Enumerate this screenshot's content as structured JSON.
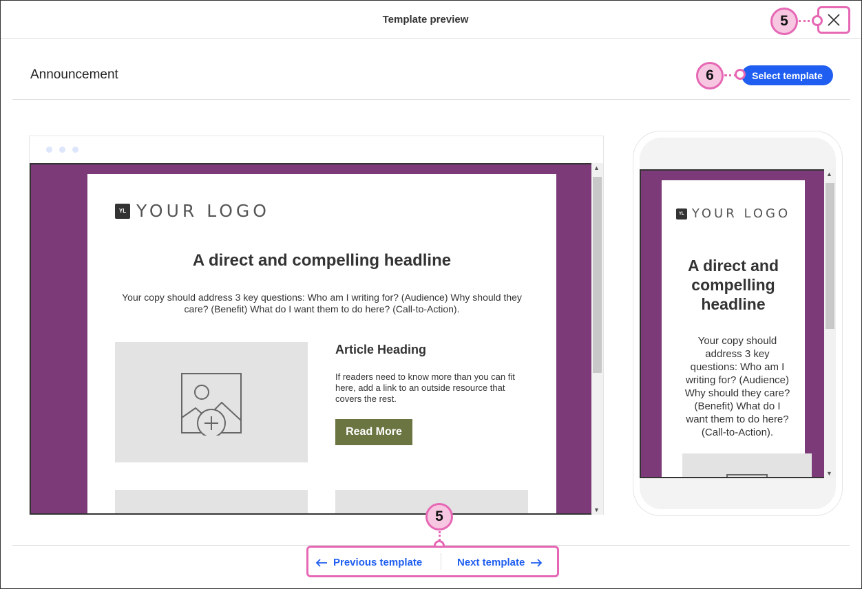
{
  "modal": {
    "title": "Template preview",
    "close_icon": "close-icon"
  },
  "template": {
    "name": "Announcement",
    "select_label": "Select template"
  },
  "email": {
    "logo_mark": "YL",
    "logo_text": "YOUR LOGO",
    "headline": "A direct and compelling headline",
    "copy": "Your copy should address 3 key questions: Who am I writing for? (Audience) Why should they care? (Benefit) What do I want them to do here? (Call-to-Action).",
    "article_heading": "Article Heading",
    "article_body": "If readers need to know more than you can fit here, add a link to an outside resource that covers the rest.",
    "read_more_label": "Read More",
    "image_icon": "image-add-icon"
  },
  "navigation": {
    "previous_label": "Previous template",
    "next_label": "Next template"
  },
  "callouts": {
    "close": "5",
    "select": "6",
    "nav": "5"
  },
  "colors": {
    "accent": "#1f5ef0",
    "email_background": "#7c3a78",
    "button": "#6b7542",
    "callout_border": "#e668b5",
    "callout_fill": "#f7c6e1"
  }
}
